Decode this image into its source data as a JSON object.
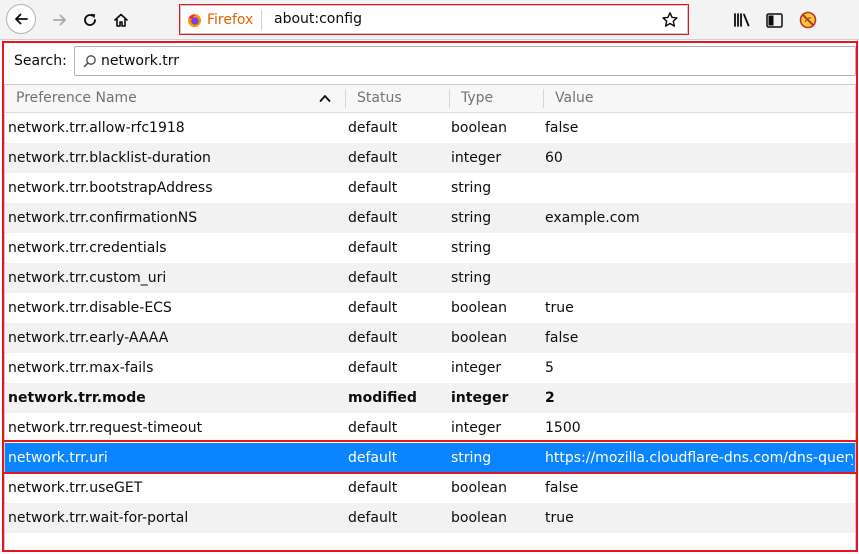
{
  "urlbar": {
    "identity_label": "Firefox",
    "url": "about:config"
  },
  "search": {
    "label": "Search:",
    "value": "network.trr"
  },
  "table": {
    "columns": {
      "name": "Preference Name",
      "status": "Status",
      "type": "Type",
      "value": "Value"
    },
    "sorted_column": "Preference Name",
    "rows": [
      {
        "name": "network.trr.allow-rfc1918",
        "status": "default",
        "type": "boolean",
        "value": "false"
      },
      {
        "name": "network.trr.blacklist-duration",
        "status": "default",
        "type": "integer",
        "value": "60"
      },
      {
        "name": "network.trr.bootstrapAddress",
        "status": "default",
        "type": "string",
        "value": ""
      },
      {
        "name": "network.trr.confirmationNS",
        "status": "default",
        "type": "string",
        "value": "example.com"
      },
      {
        "name": "network.trr.credentials",
        "status": "default",
        "type": "string",
        "value": ""
      },
      {
        "name": "network.trr.custom_uri",
        "status": "default",
        "type": "string",
        "value": ""
      },
      {
        "name": "network.trr.disable-ECS",
        "status": "default",
        "type": "boolean",
        "value": "true"
      },
      {
        "name": "network.trr.early-AAAA",
        "status": "default",
        "type": "boolean",
        "value": "false"
      },
      {
        "name": "network.trr.max-fails",
        "status": "default",
        "type": "integer",
        "value": "5"
      },
      {
        "name": "network.trr.mode",
        "status": "modified",
        "type": "integer",
        "value": "2"
      },
      {
        "name": "network.trr.request-timeout",
        "status": "default",
        "type": "integer",
        "value": "1500"
      },
      {
        "name": "network.trr.uri",
        "status": "default",
        "type": "string",
        "value": "https://mozilla.cloudflare-dns.com/dns-query"
      },
      {
        "name": "network.trr.useGET",
        "status": "default",
        "type": "boolean",
        "value": "false"
      },
      {
        "name": "network.trr.wait-for-portal",
        "status": "default",
        "type": "boolean",
        "value": "true"
      }
    ],
    "selected_row": 11,
    "modified_row": 9
  },
  "colors": {
    "selection": "#0a84ff",
    "annotation": "#e8141e",
    "identity": "#e66000",
    "alt_row": "#f2f2f2"
  },
  "icons": {
    "back": "back-arrow-icon",
    "forward": "forward-arrow-icon",
    "reload": "reload-icon",
    "home": "home-icon",
    "identity": "firefox-logo-icon",
    "bookmark": "star-icon",
    "library": "library-icon",
    "sidebar": "sidebar-icon",
    "menu": "hamburger-menu-icon",
    "noscript": "noscript-icon",
    "search": "search-icon",
    "sort": "sort-ascending-icon"
  }
}
